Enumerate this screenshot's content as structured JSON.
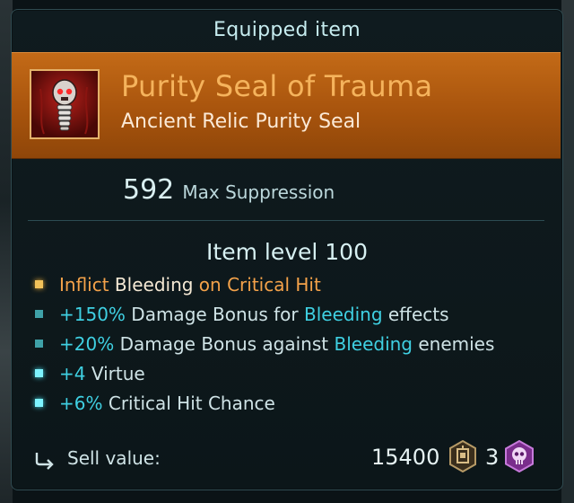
{
  "panel": {
    "title": "Equipped item"
  },
  "item": {
    "name": "Purity Seal of Trauma",
    "type": "Ancient Relic Purity Seal",
    "icon": "red-skull-relic-icon",
    "stat_value": "592",
    "stat_label": "Max Suppression",
    "level_label": "Item level 100"
  },
  "bullets": [
    {
      "dot": "gold",
      "parts": [
        "Inflict",
        " Bleeding",
        " on Critical Hit"
      ]
    },
    {
      "dot": "teal",
      "parts": [
        "+150%",
        " Damage Bonus for ",
        "Bleeding",
        " effects"
      ]
    },
    {
      "dot": "teal",
      "parts": [
        "+20%",
        " Damage Bonus against ",
        "Bleeding",
        " enemies"
      ]
    },
    {
      "dot": "cyan",
      "parts": [
        "+4",
        " Virtue"
      ]
    },
    {
      "dot": "cyan",
      "parts": [
        "+6%",
        " Critical Hit Chance"
      ]
    }
  ],
  "sell": {
    "label": "Sell value:",
    "amount": "15400",
    "currency_icon": "coin-icon",
    "secondary_count": "3",
    "secondary_icon": "skull-badge-icon"
  },
  "colors": {
    "header_orange": "#c36a17",
    "name_orange": "#f5b35c",
    "highlight_cyan": "#3fd0e2",
    "panel_bg": "#0f1b1f"
  }
}
